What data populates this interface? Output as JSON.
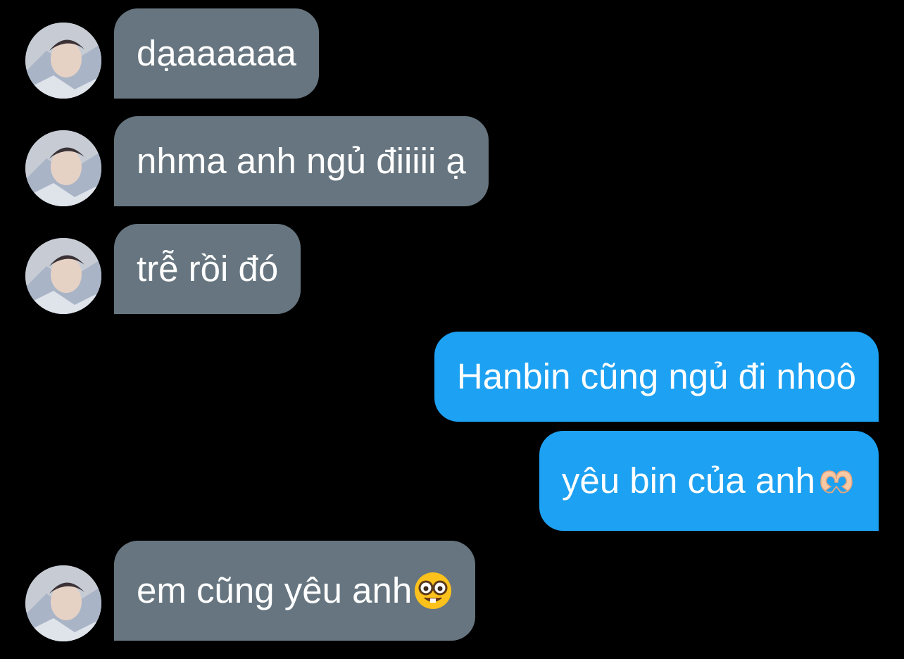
{
  "conversation": {
    "messages": [
      {
        "direction": "incoming",
        "text": "dạaaaaaa"
      },
      {
        "direction": "incoming",
        "text": "nhma anh ngủ điiiii ạ"
      },
      {
        "direction": "incoming",
        "text": "trễ rồi đó"
      },
      {
        "direction": "outgoing",
        "text": "Hanbin cũng ngủ đi nhoô"
      },
      {
        "direction": "outgoing",
        "text": "yêu bin của anh",
        "emoji": "heart-hands-emoji"
      },
      {
        "direction": "incoming",
        "text": "em cũng yêu anh",
        "emoji": "nerd-face-emoji"
      }
    ]
  },
  "colors": {
    "background": "#000000",
    "incoming_bubble": "#66757f",
    "outgoing_bubble": "#1da1f2",
    "text": "#ffffff"
  }
}
